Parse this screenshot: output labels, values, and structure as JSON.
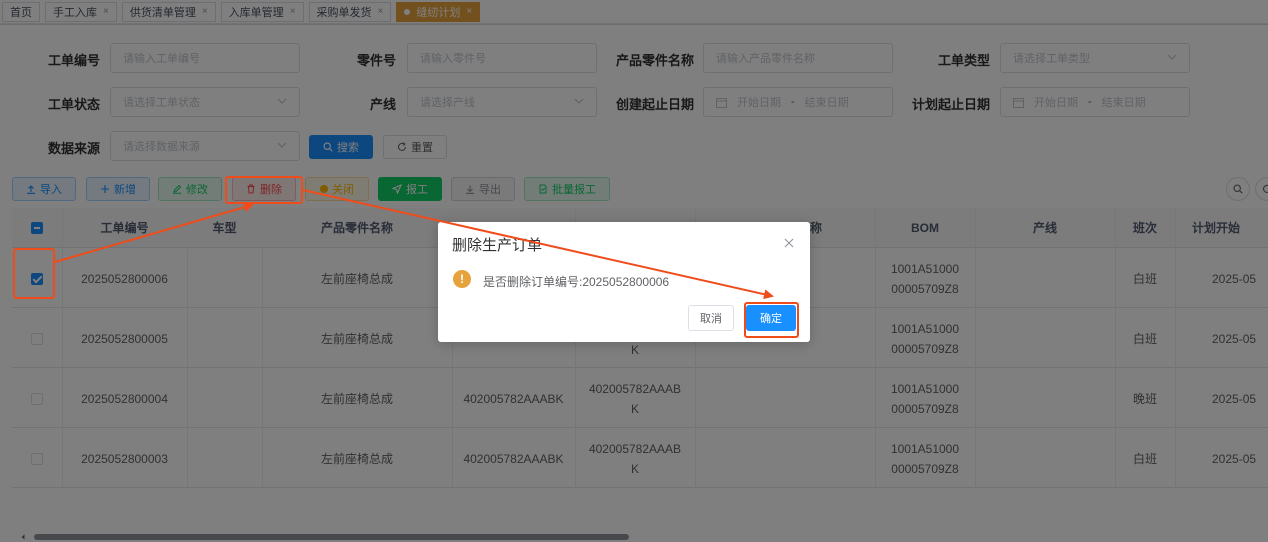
{
  "tabs": [
    {
      "label": "首页",
      "closable": false
    },
    {
      "label": "手工入库",
      "closable": true
    },
    {
      "label": "供货清单管理",
      "closable": true
    },
    {
      "label": "入库单管理",
      "closable": true
    },
    {
      "label": "采购单发货",
      "closable": true
    },
    {
      "label": "缝纫计划",
      "closable": true,
      "active": true
    }
  ],
  "tab_close_glyph": "×",
  "filters": {
    "work_order_no": {
      "label": "工单编号",
      "placeholder": "请输入工单编号"
    },
    "part_no": {
      "label": "零件号",
      "placeholder": "请输入零件号"
    },
    "part_name": {
      "label": "产品零件名称",
      "placeholder": "请输入产品零件名称"
    },
    "work_order_type": {
      "label": "工单类型",
      "placeholder": "请选择工单类型"
    },
    "work_order_status": {
      "label": "工单状态",
      "placeholder": "请选择工单状态"
    },
    "line": {
      "label": "产线",
      "placeholder": "请选择产线"
    },
    "create_date": {
      "label": "创建起止日期",
      "start": "开始日期",
      "end": "结束日期"
    },
    "plan_date": {
      "label": "计划起止日期",
      "start": "开始日期",
      "end": "结束日期"
    },
    "data_source": {
      "label": "数据来源",
      "placeholder": "请选择数据来源"
    },
    "date_sep": "-",
    "search": "搜索",
    "reset": "重置"
  },
  "toolbar": {
    "import": "导入",
    "add": "新增",
    "edit": "修改",
    "delete": "删除",
    "close": "关闭",
    "report": "报工",
    "export": "导出",
    "batch_report": "批量报工"
  },
  "table": {
    "headers": {
      "work_order_no": "工单编号",
      "vehicle": "车型",
      "part_name": "产品零件名称",
      "name_partial": "称",
      "bom": "BOM",
      "line": "产线",
      "shift": "班次",
      "plan_start": "计划开始"
    },
    "rows": [
      {
        "work_order_no": "2025052800006",
        "part_name": "左前座椅总成",
        "part_no": "",
        "part_no2": "",
        "bom": "1001A51000\n00005709Z8",
        "shift": "白班",
        "plan": "2025-05",
        "checked": true
      },
      {
        "work_order_no": "2025052800005",
        "part_name": "左前座椅总成",
        "part_no": "",
        "part_no2": "K",
        "bom": "1001A51000\n00005709Z8",
        "shift": "白班",
        "plan": "2025-05",
        "checked": false
      },
      {
        "work_order_no": "2025052800004",
        "part_name": "左前座椅总成",
        "part_no": "402005782AAABK",
        "part_no2": "402005782AAAB\nK",
        "bom": "1001A51000\n00005709Z8",
        "shift": "晚班",
        "plan": "2025-05",
        "checked": false
      },
      {
        "work_order_no": "2025052800003",
        "part_name": "左前座椅总成",
        "part_no": "402005782AAABK",
        "part_no2": "402005782AAAB\nK",
        "bom": "1001A51000\n00005709Z8",
        "shift": "白班",
        "plan": "2025-05",
        "checked": false
      }
    ]
  },
  "dialog": {
    "title": "删除生产订单",
    "message": "是否删除订单编号:2025052800006",
    "warn_glyph": "!",
    "cancel": "取消",
    "confirm": "确定"
  },
  "colors": {
    "primary": "#1890ff",
    "annotation": "#f04c1b",
    "active_tab": "#e6a23c"
  }
}
